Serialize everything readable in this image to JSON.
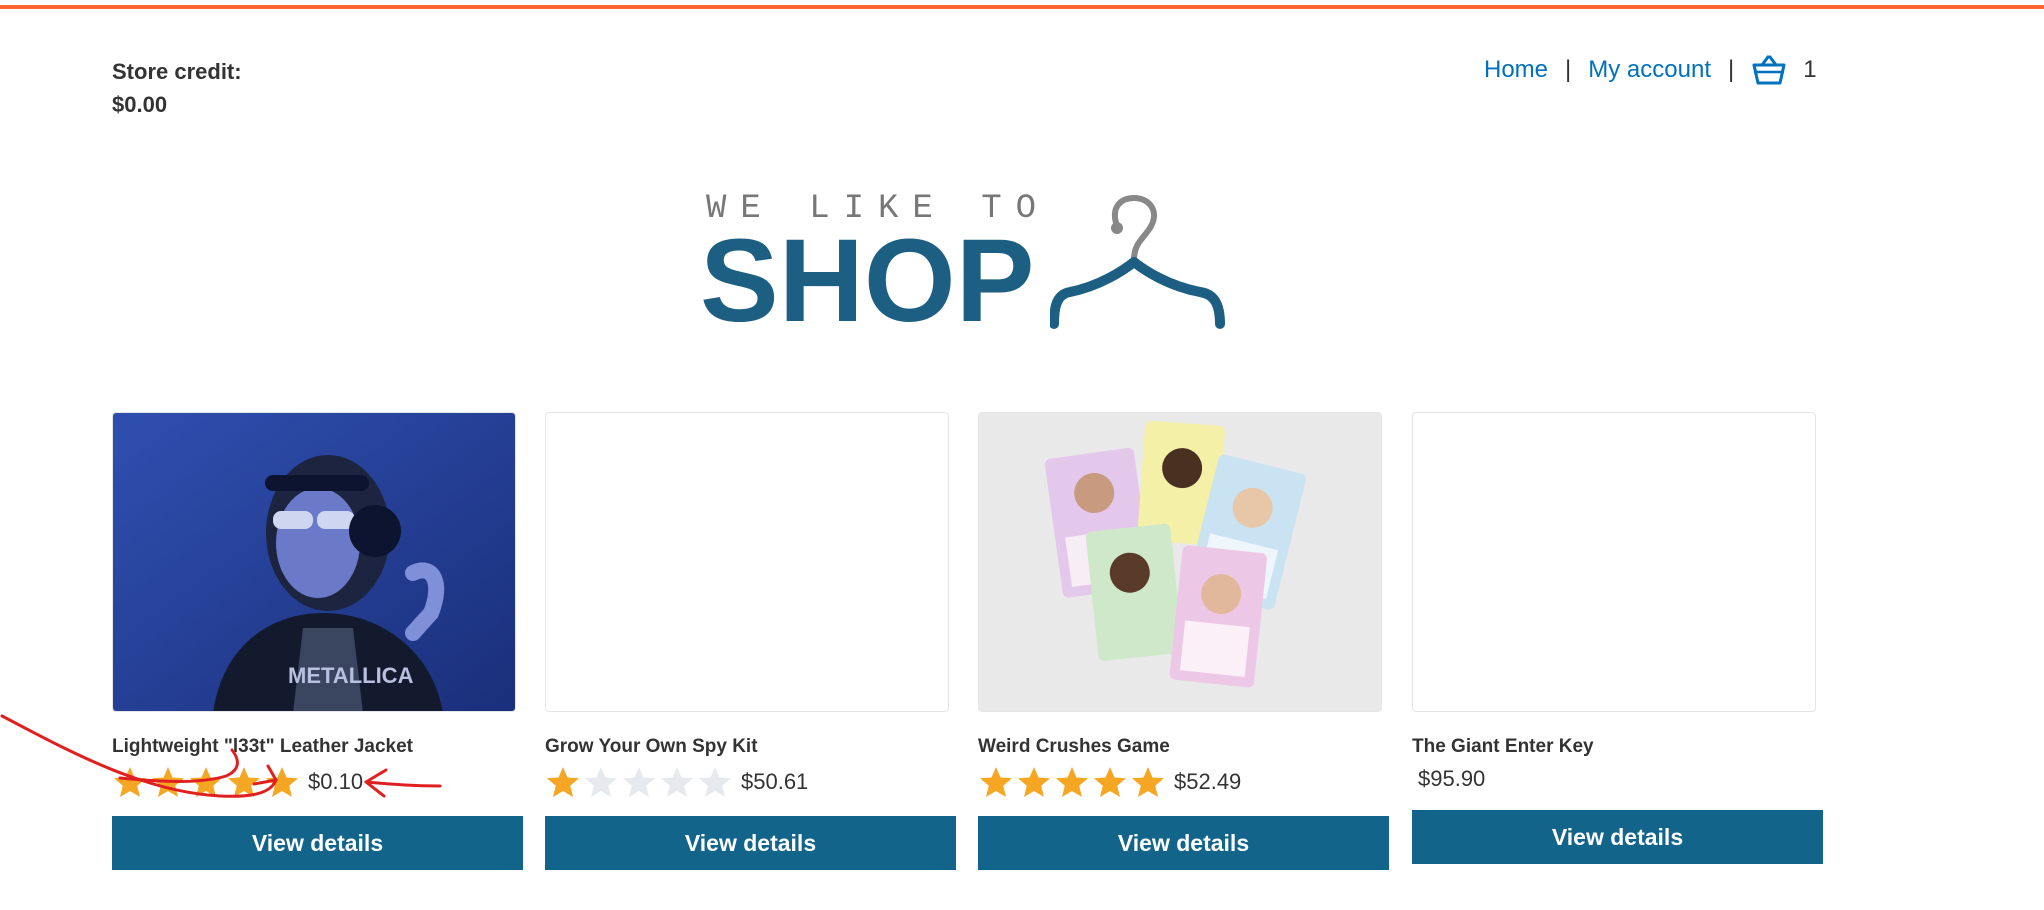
{
  "store": {
    "credit_label": "Store credit:",
    "credit_value": "$0.00"
  },
  "nav": {
    "home": "Home",
    "account": "My account",
    "sep": "|",
    "cart_icon": "basket-icon",
    "cart_count": "1"
  },
  "logo": {
    "tagline": "WE LIKE TO",
    "word": "SHOP",
    "icon": "hanger-icon"
  },
  "colors": {
    "accent_bar": "#ff6633",
    "button": "#12648a",
    "link": "#0071bc",
    "logo": "#1c5f82",
    "star": "#f5a623",
    "star_empty": "#e6eaee",
    "annotation": "#e02020"
  },
  "products": [
    {
      "title": "Lightweight \"l33t\" Leather Jacket",
      "rating": 5,
      "price": "$0.10",
      "button": "View details",
      "image": "woman-with-headphones-photo"
    },
    {
      "title": "Grow Your Own Spy Kit",
      "rating": 1,
      "price": "$50.61",
      "button": "View details",
      "image": "blank"
    },
    {
      "title": "Weird Crushes Game",
      "rating": 5,
      "price": "$52.49",
      "button": "View details",
      "image": "trading-cards-photo"
    },
    {
      "title": "The Giant Enter Key",
      "rating": 0,
      "price": "$95.90",
      "button": "View details",
      "image": "blank"
    }
  ]
}
